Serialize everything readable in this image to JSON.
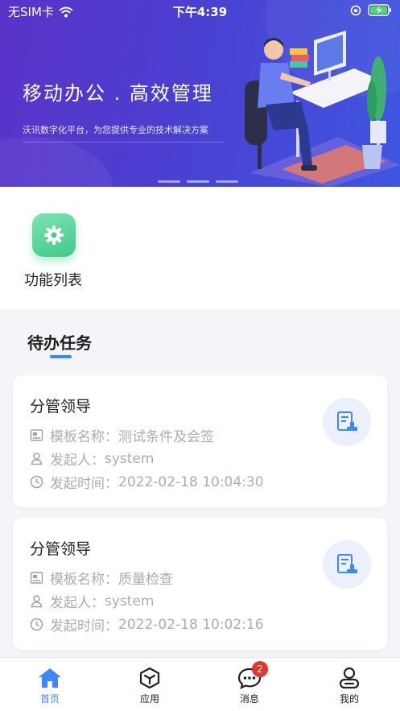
{
  "status_bar": {
    "carrier": "无SIM卡",
    "time": "下午4:39",
    "wifi_icon": "wifi-icon",
    "battery_icon": "battery-charging-icon"
  },
  "banner": {
    "title": "移动办公 . 高效管理",
    "subtitle": "沃讯数字化平台，为您提供专业的技术解决方案",
    "pages": 3,
    "active_page": 2
  },
  "functions": {
    "items": [
      {
        "label": "功能列表",
        "icon": "gear-icon",
        "color": "#46cd8f"
      }
    ]
  },
  "todo": {
    "title": "待办任务",
    "tasks": [
      {
        "title": "分管领导",
        "template_label": "模板名称：",
        "template_value": "测试条件及会签",
        "initiator_label": "发起人：",
        "initiator_value": "system",
        "time_label": "发起时间：",
        "time_value": "2022-02-18 10:04:30"
      },
      {
        "title": "分管领导",
        "template_label": "模板名称：",
        "template_value": "质量检查",
        "initiator_label": "发起人：",
        "initiator_value": "system",
        "time_label": "发起时间：",
        "time_value": "2022-02-18 10:02:16"
      }
    ]
  },
  "tabbar": {
    "tabs": [
      {
        "label": "首页",
        "icon": "home-icon",
        "active": true
      },
      {
        "label": "应用",
        "icon": "cube-icon",
        "active": false
      },
      {
        "label": "消息",
        "icon": "chat-icon",
        "active": false,
        "badge": "2"
      },
      {
        "label": "我的",
        "icon": "user-icon",
        "active": false
      }
    ]
  },
  "colors": {
    "accent": "#3f86f6",
    "banner_start": "#5a33c9",
    "banner_end": "#3e56e0",
    "badge_red": "#e8332f",
    "muted_text": "#a9adb4"
  }
}
